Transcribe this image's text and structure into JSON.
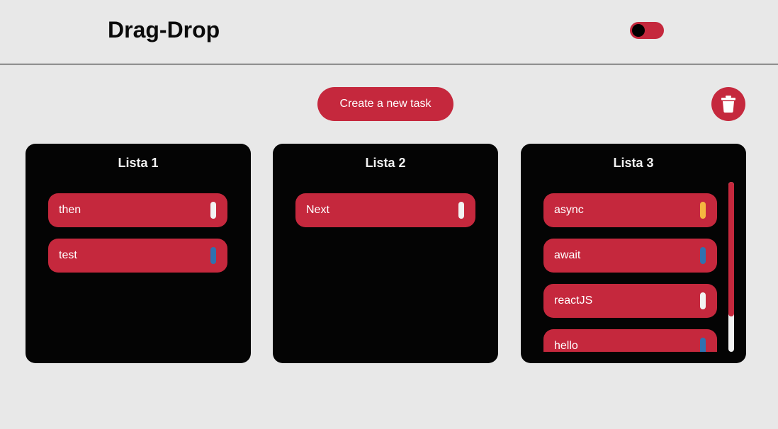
{
  "header": {
    "title": "Drag-Drop"
  },
  "toolbar": {
    "create_label": "Create a new task"
  },
  "colors": {
    "accent": "#c5283d",
    "panel": "#040404",
    "background": "#e8e8e8",
    "tag_white": "#f2f2f2",
    "tag_blue": "#2f72b0",
    "tag_yellow": "#f5b740"
  },
  "icons": {
    "trash": "trash-icon"
  },
  "lists": [
    {
      "title": "Lista 1",
      "cards": [
        {
          "label": "then",
          "tag": "white"
        },
        {
          "label": "test",
          "tag": "blue"
        }
      ]
    },
    {
      "title": "Lista 2",
      "cards": [
        {
          "label": "Next",
          "tag": "white"
        }
      ]
    },
    {
      "title": "Lista 3",
      "cards": [
        {
          "label": "async",
          "tag": "yellow"
        },
        {
          "label": "await",
          "tag": "blue"
        },
        {
          "label": "reactJS",
          "tag": "white"
        },
        {
          "label": "hello",
          "tag": "blue"
        }
      ]
    }
  ]
}
